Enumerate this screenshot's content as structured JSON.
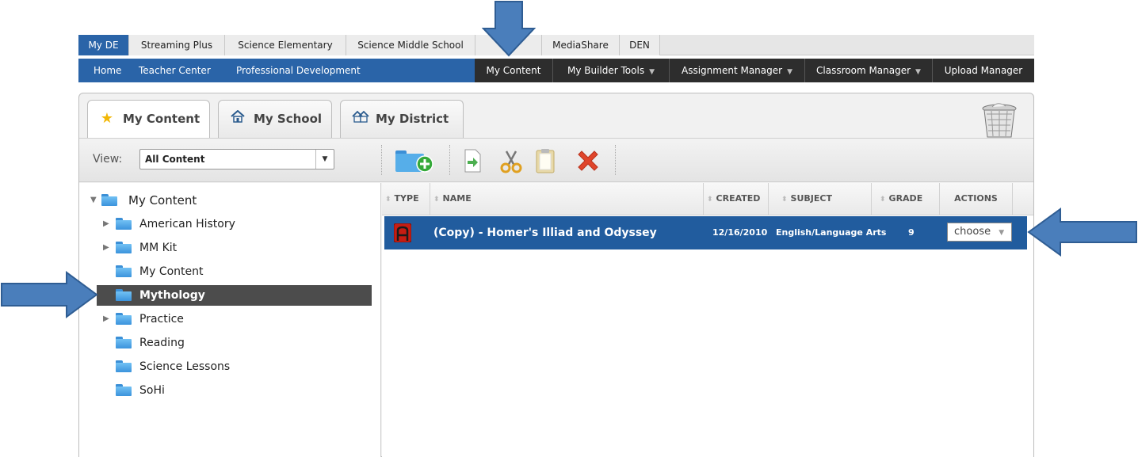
{
  "top_tabs": [
    "My DE",
    "Streaming Plus",
    "Science Elementary",
    "Science Middle School",
    "MediaShare",
    "DEN"
  ],
  "sub_nav": {
    "left_links": [
      "Home",
      "Teacher Center",
      "Professional Development"
    ],
    "menu": [
      {
        "label": "My Content",
        "dropdown": false
      },
      {
        "label": "My Builder Tools",
        "dropdown": true
      },
      {
        "label": "Assignment Manager",
        "dropdown": true
      },
      {
        "label": "Classroom Manager",
        "dropdown": true
      },
      {
        "label": "Upload Manager",
        "dropdown": false
      }
    ]
  },
  "content_tabs": [
    "My Content",
    "My School",
    "My District"
  ],
  "view": {
    "label": "View:",
    "selected": "All Content"
  },
  "tree": {
    "root": "My Content",
    "items": [
      {
        "label": "American History",
        "expandable": true
      },
      {
        "label": "MM Kit",
        "expandable": true
      },
      {
        "label": "My Content",
        "expandable": false
      },
      {
        "label": "Mythology",
        "expandable": false,
        "selected": true
      },
      {
        "label": "Practice",
        "expandable": true
      },
      {
        "label": "Reading",
        "expandable": false
      },
      {
        "label": "Science Lessons",
        "expandable": false
      },
      {
        "label": "SoHi",
        "expandable": false
      }
    ]
  },
  "grid": {
    "columns": [
      "TYPE",
      "NAME",
      "CREATED",
      "SUBJECT",
      "GRADE",
      "ACTIONS"
    ],
    "rows": [
      {
        "type_icon": "assignment-icon",
        "name": "(Copy) - Homer's Illiad and Odyssey",
        "created": "12/16/2010",
        "subject": "English/Language Arts",
        "grade": "9",
        "action": "choose"
      }
    ]
  },
  "colors": {
    "nav_blue": "#2a64a8",
    "row_blue": "#215c9e",
    "dark_menu": "#2d2d2d",
    "callout_arrow": "#4a7ebb"
  }
}
